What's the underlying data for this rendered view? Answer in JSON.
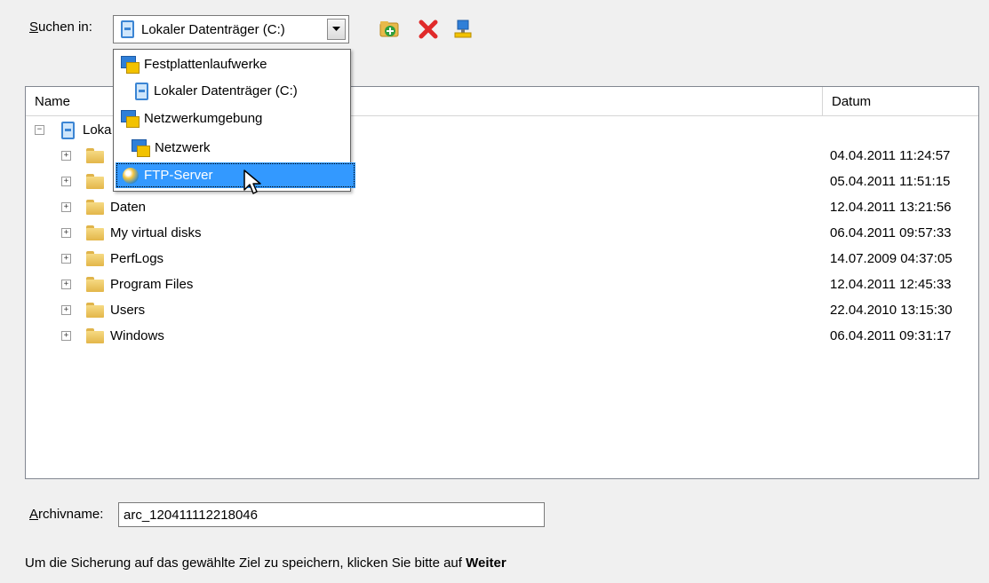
{
  "search": {
    "label_accel": "S",
    "label_rest": "uchen in:",
    "current": "Lokaler Datenträger (C:)"
  },
  "toolbar": {
    "icons": [
      "new-folder-icon",
      "delete-icon",
      "network-connect-icon"
    ]
  },
  "list": {
    "columns": {
      "name": "Name",
      "date": "Datum"
    },
    "root_partial": "Loka",
    "rows": [
      {
        "name": "",
        "date": "04.04.2011 11:24:57"
      },
      {
        "name": "",
        "date": "05.04.2011 11:51:15"
      },
      {
        "name": "Daten",
        "date": "12.04.2011 13:21:56"
      },
      {
        "name": "My virtual disks",
        "date": "06.04.2011 09:57:33"
      },
      {
        "name": "PerfLogs",
        "date": "14.07.2009 04:37:05"
      },
      {
        "name": "Program Files",
        "date": "12.04.2011 12:45:33"
      },
      {
        "name": "Users",
        "date": "22.04.2010 13:15:30"
      },
      {
        "name": "Windows",
        "date": "06.04.2011 09:31:17"
      }
    ]
  },
  "dropdown": {
    "items": [
      {
        "label": "Festplattenlaufwerke"
      },
      {
        "label": "Lokaler Datenträger (C:)"
      },
      {
        "label": "Netzwerkumgebung"
      },
      {
        "label": "Netzwerk"
      },
      {
        "label": "FTP-Server",
        "selected": true
      }
    ]
  },
  "archive": {
    "label_accel": "A",
    "label_rest": "rchivname:",
    "value": "arc_120411112218046"
  },
  "hint": {
    "text": "Um die Sicherung auf das gewählte Ziel zu speichern, klicken Sie bitte auf ",
    "bold": "Weiter"
  },
  "colors": {
    "selection": "#3399ff",
    "accent": "#3b85d4"
  }
}
